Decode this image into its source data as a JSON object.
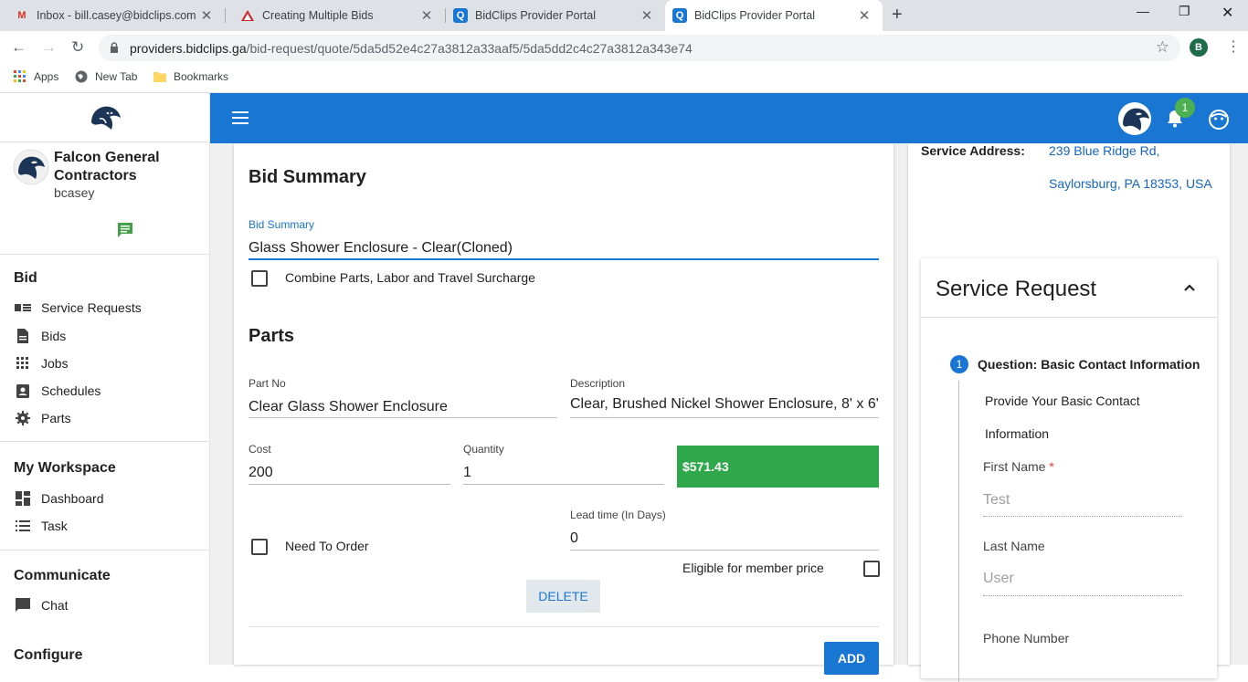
{
  "browser": {
    "tabs": [
      {
        "title": "Inbox - bill.casey@bidclips.com -",
        "icon": "gmail-icon"
      },
      {
        "title": "Creating Multiple Bids",
        "icon": "doc-icon"
      },
      {
        "title": "BidClips Provider Portal",
        "icon": "bidclips-icon"
      },
      {
        "title": "BidClips Provider Portal",
        "icon": "bidclips-icon"
      }
    ],
    "url_host": "providers.bidclips.ga",
    "url_path": "/bid-request/quote/5da5d52e4c27a3812a33aaf5/5da5dd2c4c27a3812a343e74",
    "profile_initial": "B",
    "bookmarks": [
      "Apps",
      "New Tab",
      "Bookmarks"
    ]
  },
  "sidebar": {
    "company_line1": "Falcon General",
    "company_line2": "Contractors",
    "username": "bcasey",
    "sections": [
      {
        "title": "Bid",
        "items": [
          "Service Requests",
          "Bids",
          "Jobs",
          "Schedules",
          "Parts"
        ]
      },
      {
        "title": "My Workspace",
        "items": [
          "Dashboard",
          "Task"
        ]
      },
      {
        "title": "Communicate",
        "items": [
          "Chat"
        ]
      },
      {
        "title": "Configure",
        "items": []
      }
    ]
  },
  "appbar": {
    "notification_count": "1"
  },
  "bid": {
    "section_title": "Bid Summary",
    "summary_label": "Bid Summary",
    "summary_value": "Glass Shower Enclosure - Clear(Cloned)",
    "combine_label": "Combine Parts, Labor and Travel Surcharge",
    "parts_title": "Parts",
    "part_no_label": "Part No",
    "part_no_value": "Clear Glass Shower Enclosure",
    "description_label": "Description",
    "description_value": "Clear, Brushed Nickel Shower Enclosure, 8' x 6'",
    "cost_label": "Cost",
    "cost_value": "200",
    "quantity_label": "Quantity",
    "quantity_value": "1",
    "total": "$571.43",
    "need_to_order_label": "Need To Order",
    "lead_time_label": "Lead time (In Days)",
    "lead_time_value": "0",
    "member_price_label": "Eligible for member price",
    "delete_label": "DELETE",
    "add_label": "ADD"
  },
  "service": {
    "address_label": "Service Address:",
    "address_line1": "239 Blue Ridge Rd,",
    "address_line2": "Saylorsburg, PA 18353, USA",
    "request_title": "Service Request",
    "step_number": "1",
    "step_title": "Question: Basic Contact Information",
    "step_desc_line1": "Provide Your Basic Contact",
    "step_desc_line2": "Information",
    "first_name_label": "First Name",
    "required_mark": "*",
    "first_name_value": "Test",
    "last_name_label": "Last Name",
    "last_name_value": "User",
    "phone_label": "Phone Number"
  },
  "colors": {
    "primary": "#1976d2",
    "success": "#2ea84a",
    "link": "#1565c0",
    "chat_green": "#43a047"
  }
}
